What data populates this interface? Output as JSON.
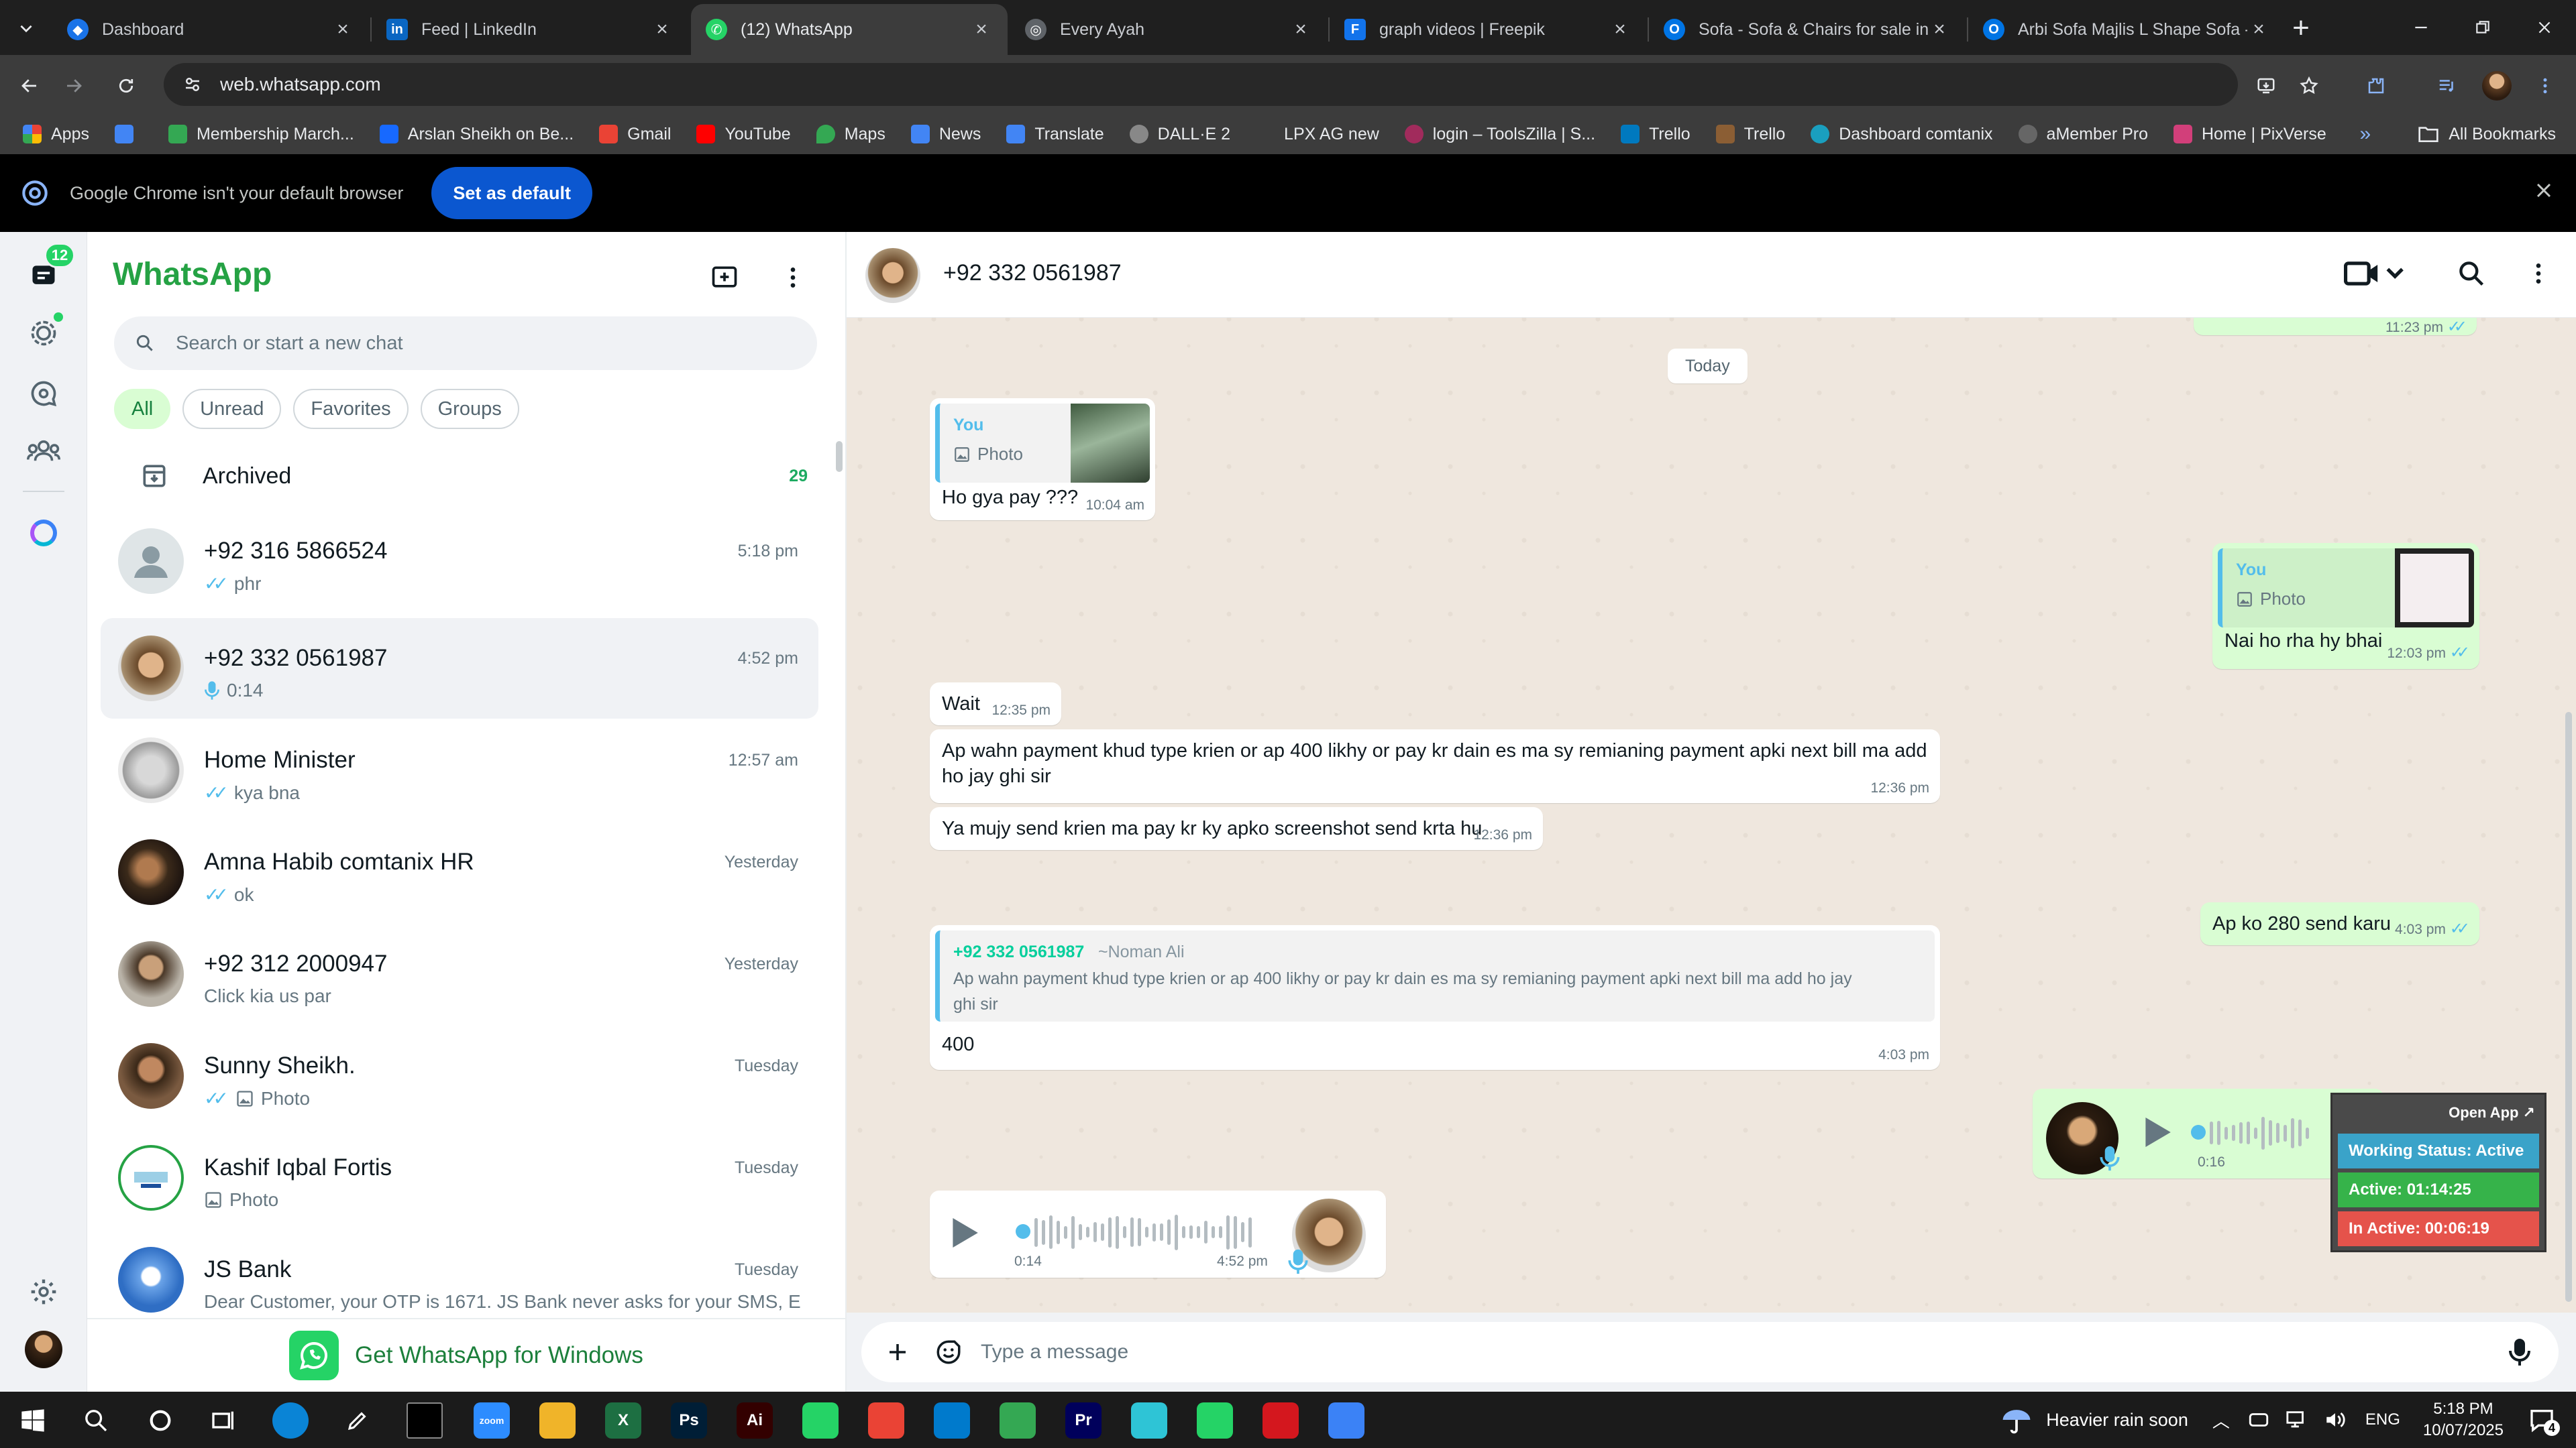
{
  "browser": {
    "tabs": [
      {
        "title": "Dashboard",
        "color": "#1a73e8",
        "glyph": "◆"
      },
      {
        "title": "Feed | LinkedIn",
        "color": "#0a66c2",
        "glyph": "in"
      },
      {
        "title": "(12) WhatsApp",
        "color": "#25d366",
        "glyph": "✆"
      },
      {
        "title": "Every Ayah",
        "color": "#5f6368",
        "glyph": "◎"
      },
      {
        "title": "graph videos | Freepik",
        "color": "#1273eb",
        "glyph": "F"
      },
      {
        "title": "Sofa - Sofa & Chairs for sale in",
        "color": "#0074e4",
        "glyph": "O"
      },
      {
        "title": "Arbi Sofa Majlis L Shape Sofa -",
        "color": "#0074e4",
        "glyph": "O"
      }
    ],
    "url": "web.whatsapp.com",
    "bookmarks": [
      {
        "label": "Apps",
        "color": "#ea4335"
      },
      {
        "label": "",
        "color": "#4285f4"
      },
      {
        "label": "Membership March...",
        "color": "#34a853"
      },
      {
        "label": "Arslan Sheikh on Be...",
        "color": "#1769ff"
      },
      {
        "label": "Gmail",
        "color": "#ea4335"
      },
      {
        "label": "YouTube",
        "color": "#ff0000"
      },
      {
        "label": "Maps",
        "color": "#34a853"
      },
      {
        "label": "News",
        "color": "#4285f4"
      },
      {
        "label": "Translate",
        "color": "#4285f4"
      },
      {
        "label": "DALL·E 2",
        "color": "#888888"
      },
      {
        "label": "LPX AG new",
        "color": "#3c3c3c"
      },
      {
        "label": "login – ToolsZilla | S...",
        "color": "#a12b5c"
      },
      {
        "label": "Trello",
        "color": "#0079bf"
      },
      {
        "label": "Trello",
        "color": "#0079bf"
      },
      {
        "label": "Dashboard comtanix",
        "color": "#1a9fbf"
      },
      {
        "label": "aMember Pro",
        "color": "#666666"
      },
      {
        "label": "Home | PixVerse",
        "color": "#d23f7a"
      }
    ],
    "all_bookmarks": "All Bookmarks",
    "infobar": {
      "message": "Google Chrome isn't your default browser",
      "button": "Set as default"
    }
  },
  "whatsapp": {
    "rail_badge": "12",
    "title": "WhatsApp",
    "search_placeholder": "Search or start a new chat",
    "filters": [
      "All",
      "Unread",
      "Favorites",
      "Groups"
    ],
    "archived": {
      "label": "Archived",
      "count": "29"
    },
    "chats": [
      {
        "name": "+92 316 5866524",
        "time": "5:18 pm",
        "preview": "phr",
        "tick": true,
        "icon": ""
      },
      {
        "name": "+92 332 0561987",
        "time": "4:52 pm",
        "preview": "0:14",
        "tick": false,
        "icon": "mic"
      },
      {
        "name": "Home Minister",
        "time": "12:57 am",
        "preview": "kya bna",
        "tick": true,
        "icon": ""
      },
      {
        "name": "Amna Habib comtanix HR",
        "time": "Yesterday",
        "preview": "ok",
        "tick": true,
        "icon": ""
      },
      {
        "name": "+92 312 2000947",
        "time": "Yesterday",
        "preview": "Click kia us par",
        "tick": false,
        "icon": ""
      },
      {
        "name": "Sunny Sheikh.",
        "time": "Tuesday",
        "preview": "Photo",
        "tick": true,
        "icon": "photo"
      },
      {
        "name": "Kashif Iqbal Fortis",
        "time": "Tuesday",
        "preview": "Photo",
        "tick": false,
        "icon": "photo"
      },
      {
        "name": "JS Bank",
        "time": "Tuesday",
        "preview": "Dear Customer, your OTP is 1671. JS Bank never asks for your SMS, E...",
        "tick": false,
        "icon": ""
      }
    ],
    "get_app": "Get WhatsApp for Windows",
    "conversation": {
      "contact": "+92 332 0561987",
      "top_cut_time": "11:23 pm",
      "day_label": "Today",
      "quote_you": "You",
      "quote_photo": "Photo",
      "msg1_text": "Ho gya pay ???",
      "msg1_time": "10:04 am",
      "msg2_text": "Nai ho rha hy bhai",
      "msg2_time": "12:03 pm",
      "msg3_text": "Wait",
      "msg3_time": "12:35 pm",
      "msg4_line1": "Ap wahn payment khud type krien or ap 400 likhy or pay kr dain es ma sy remianing payment apki next bill ma add",
      "msg4_line2": "ho jay ghi sir",
      "msg4_time": "12:36 pm",
      "msg5_text": "Ya mujy send krien ma pay kr ky apko screenshot send krta hu",
      "msg5_time": "12:36 pm",
      "msg6_text": "Ap ko 280 send karu",
      "msg6_time": "4:03 pm",
      "reply_author": "+92 332 0561987",
      "reply_alias": "~Noman Ali",
      "reply_line1": "Ap wahn payment khud type krien or ap 400 likhy or pay kr dain es ma sy remianing payment apki next bill ma add ho jay",
      "reply_line2": "ghi sir",
      "msg7_text": "400",
      "msg7_time": "4:03 pm",
      "voice_out_duration": "0:16",
      "voice_out_progress": 0,
      "voice_in_duration": "0:14",
      "voice_in_time": "4:52 pm",
      "voice_in_progress": 0,
      "compose_placeholder": "Type a message"
    },
    "status_widget": {
      "open_app": "Open App ↗",
      "working": "Working Status: Active",
      "active": "Active: 01:14:25",
      "inactive": "In Active: 00:06:19",
      "colors": {
        "working": "#3aa3c9",
        "active": "#36b34a",
        "inactive": "#e5534b"
      }
    }
  },
  "taskbar": {
    "weather": "Heavier rain soon",
    "lang": "ENG",
    "time": "5:18 PM",
    "date": "10/07/2025",
    "notif_count": "4",
    "apps": [
      {
        "name": "zoom",
        "glyph": "zoom",
        "color": "#2d8cff"
      },
      {
        "name": "files",
        "glyph": "",
        "color": "#f0b429"
      },
      {
        "name": "excel",
        "glyph": "X",
        "color": "#1d6f42"
      },
      {
        "name": "photoshop",
        "glyph": "Ps",
        "color": "#001e36"
      },
      {
        "name": "illustrator",
        "glyph": "Ai",
        "color": "#330000"
      },
      {
        "name": "phone",
        "glyph": "",
        "color": "#25d366"
      },
      {
        "name": "chrome",
        "glyph": "",
        "color": "#ea4335"
      },
      {
        "name": "vscode",
        "glyph": "",
        "color": "#007acc"
      },
      {
        "name": "chrome-profile",
        "glyph": "",
        "color": "#34a853"
      },
      {
        "name": "premiere",
        "glyph": "Pr",
        "color": "#00005b"
      },
      {
        "name": "app-blue",
        "glyph": "",
        "color": "#2ec4d6"
      },
      {
        "name": "phone-2",
        "glyph": "",
        "color": "#25d366"
      },
      {
        "name": "acrobat",
        "glyph": "",
        "color": "#d4171e"
      },
      {
        "name": "calculator",
        "glyph": "",
        "color": "#3b82f6"
      }
    ]
  }
}
